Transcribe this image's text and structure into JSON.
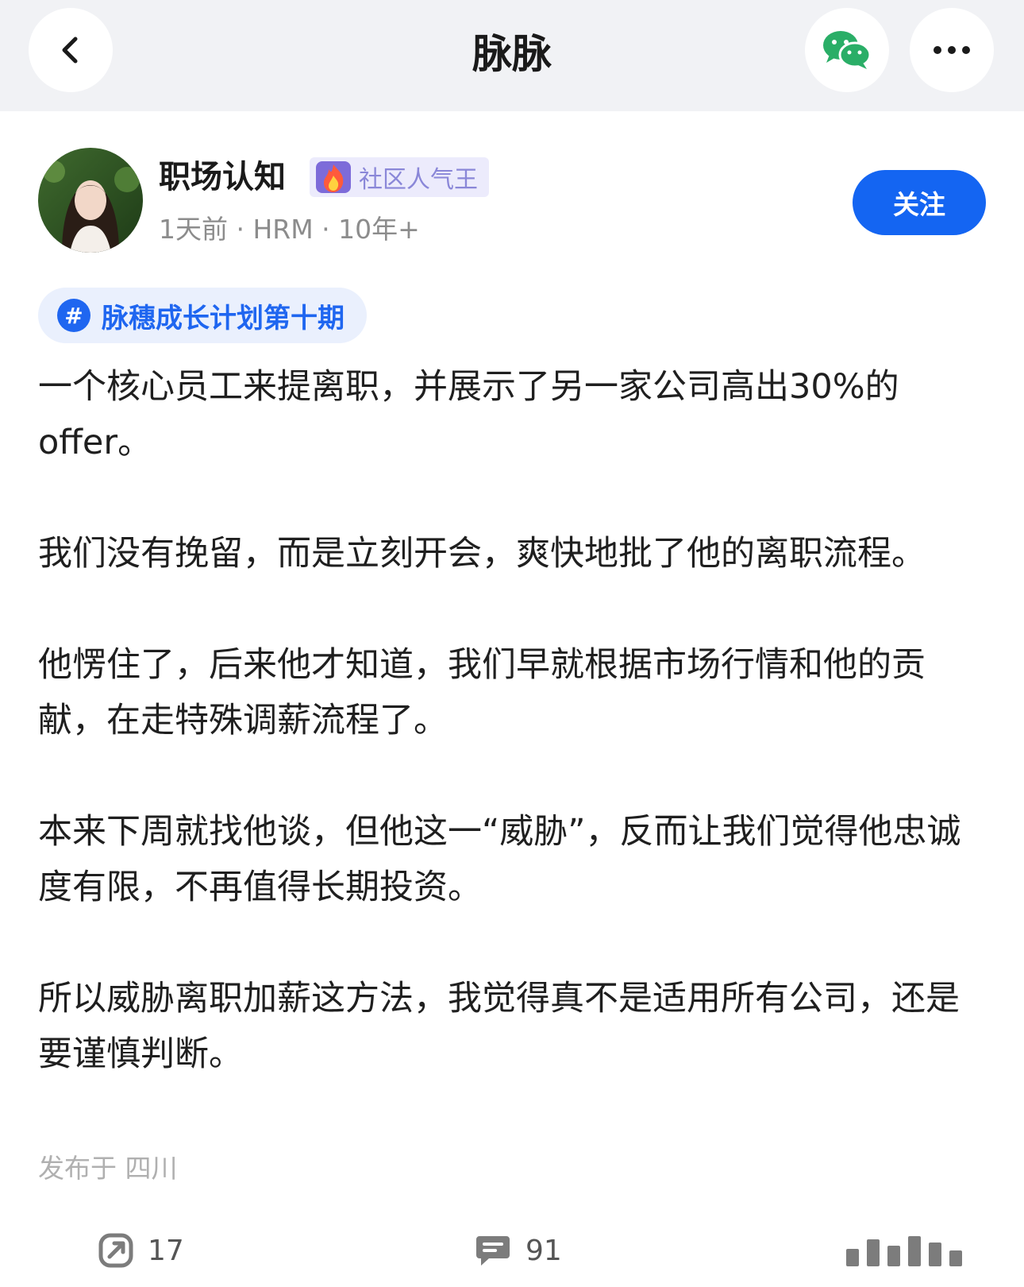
{
  "nav": {
    "title": "脉脉",
    "back_icon": "chevron-left-icon",
    "share_icon": "wechat-icon",
    "more_icon": "more-horizontal-icon"
  },
  "author": {
    "name": "职场认知",
    "badge_label": "社区人气王",
    "meta": "1天前 · HRM · 10年+",
    "follow_label": "关注"
  },
  "topic": {
    "icon_text": "#",
    "label": "脉穗成长计划第十期"
  },
  "post": {
    "paragraphs": [
      "一个核心员工来提离职，并展示了另一家公司高出30%的offer。",
      "我们没有挽留，而是立刻开会，爽快地批了他的离职流程。",
      "他愣住了，后来他才知道，我们早就根据市场行情和他的贡献，在走特殊调薪流程了。",
      "本来下周就找他谈，但他这一“威胁”，反而让我们觉得他忠诚度有限，不再值得长期投资。",
      "所以威胁离职加薪这方法，我觉得真不是适用所有公司，还是要谨慎判断。"
    ],
    "location": "发布于 四川"
  },
  "actions": {
    "share_count": "17",
    "comment_count": "91"
  },
  "colors": {
    "brand_blue": "#1465f2",
    "topic_blue": "#1f66f0",
    "wechat_green": "#2aae67",
    "badge_purple": "#8a87d8"
  }
}
